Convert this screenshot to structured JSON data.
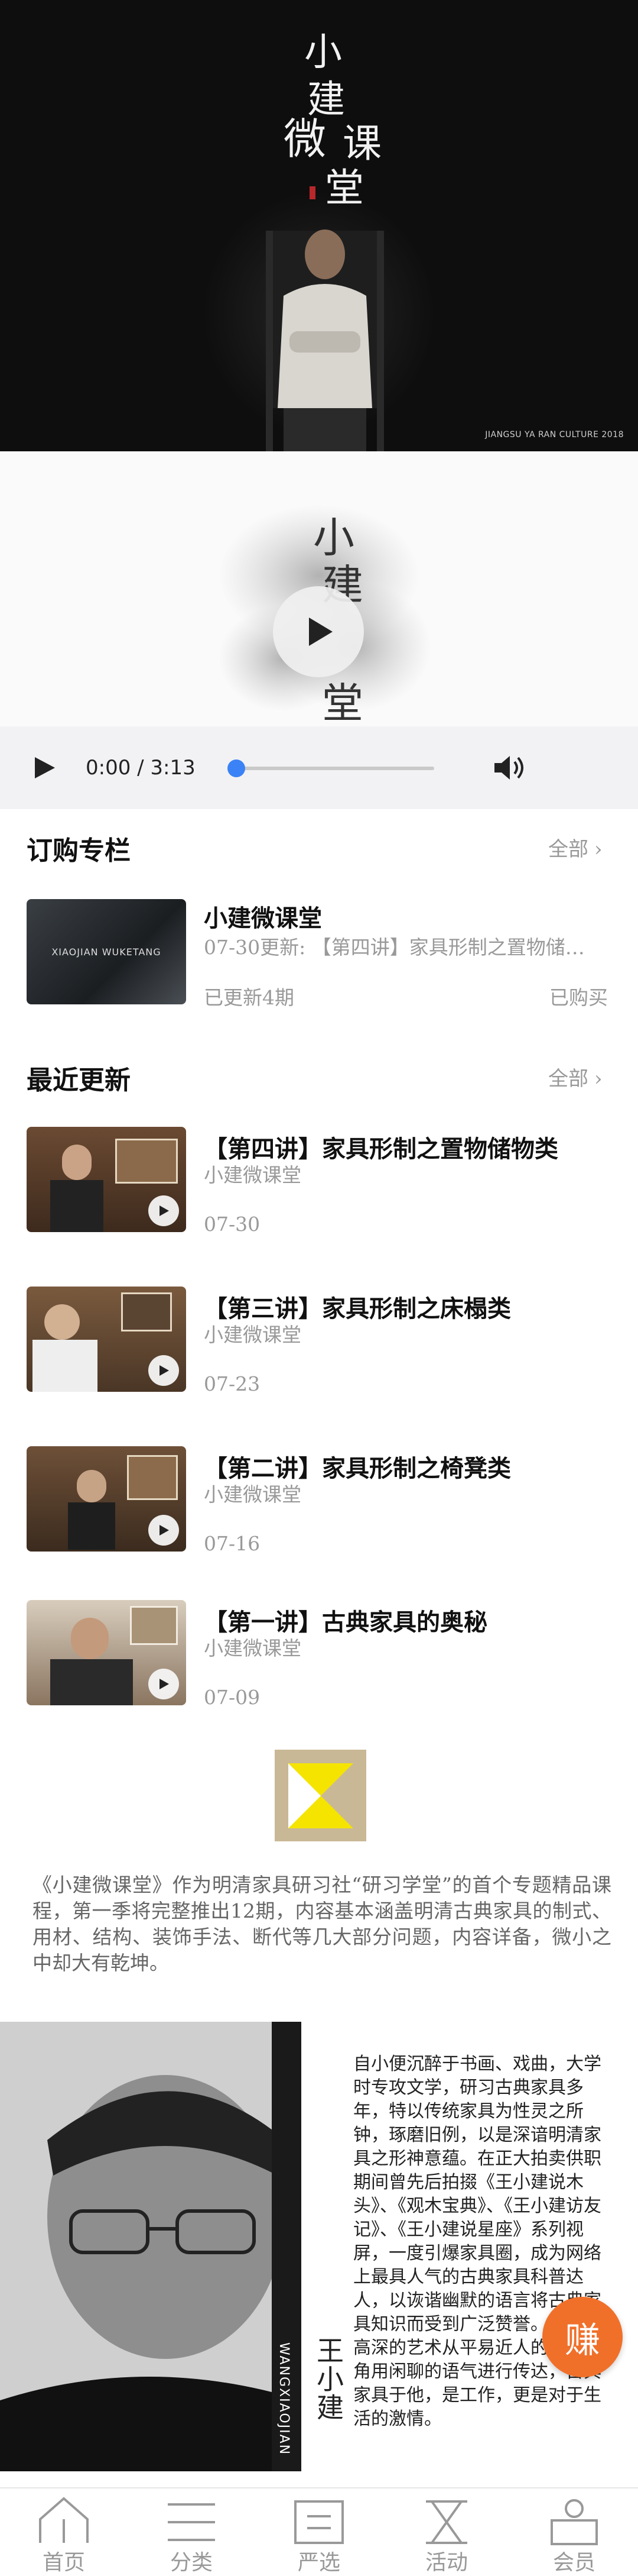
{
  "hero": {
    "calligraphy": [
      "小",
      "建",
      "微",
      "课",
      "堂"
    ],
    "credit": "JIANGSU YA RAN CULTURE 2018"
  },
  "player": {
    "time": "0:00 / 3:13",
    "progress": 0
  },
  "subscriptions": {
    "title": "订购专栏",
    "all_label": "全部",
    "item": {
      "thumb_text": "XIAOJIAN WUKETANG",
      "title": "小建微课堂",
      "update": "07-30更新: 【第四讲】家具形制之置物储…",
      "count": "已更新4期",
      "status": "已购买"
    }
  },
  "recent": {
    "title": "最近更新",
    "all_label": "全部",
    "items": [
      {
        "title": "【第四讲】家具形制之置物储物类",
        "source": "小建微课堂",
        "date": "07-30"
      },
      {
        "title": "【第三讲】家具形制之床榻类",
        "source": "小建微课堂",
        "date": "07-23"
      },
      {
        "title": "【第二讲】家具形制之椅凳类",
        "source": "小建微课堂",
        "date": "07-16"
      },
      {
        "title": "【第一讲】古典家具的奥秘",
        "source": "小建微课堂",
        "date": "07-09"
      }
    ]
  },
  "intro": {
    "text": "《小建微课堂》作为明清家具研习社“研习学堂”的首个专题精品课程，第一季将完整推出12期，内容基本涵盖明清古典家具的制式、用材、结构、装饰手法、断代等几大部分问题，内容详备，微小之中却大有乾坤。"
  },
  "bio": {
    "text": "自小便沉醉于书画、戏曲，大学时专攻文学，研习古典家具多年，特以传统家具为性灵之所钟，琢磨旧例，以是深谙明清家具之形神意蕴。在正大拍卖供职期间曾先后拍掇《王小建说木头》、《观木宝典》、《王小建访友记》、《王小建说星座》系列视屏，一度引爆家具圈，成为网络上最具人气的古典家具科普达人，以诙谐幽默的语言将古典家具知识而受到广泛赞誉。擅长把高深的艺术从平易近人的独特视角用闲聊的语气进行传达，古典家具于他，是工作，更是对于生活的激情。",
    "name": "王小建",
    "pinyin": "WANGXIAOJIAN"
  },
  "earn_button": "赚",
  "tabs": [
    {
      "label": "首页",
      "icon": "home-icon"
    },
    {
      "label": "分类",
      "icon": "category-icon"
    },
    {
      "label": "严选",
      "icon": "selection-icon"
    },
    {
      "label": "活动",
      "icon": "activity-icon"
    },
    {
      "label": "会员",
      "icon": "member-icon"
    }
  ],
  "colors": {
    "accent": "#3b82f6",
    "earn": "#f0702a",
    "logo_bg": "#c9b896",
    "logo_fg": "#f5e400"
  }
}
